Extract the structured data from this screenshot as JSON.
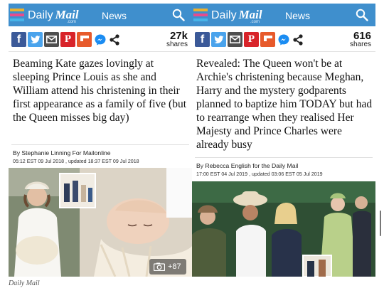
{
  "brand": {
    "name_part1": "Daily",
    "name_part2": "Mail",
    "sub": ".com"
  },
  "colors": {
    "topbar": "#3f8fcd",
    "facebook": "#3b5998",
    "twitter": "#4aa3ec",
    "email": "#4f4f4f",
    "pinterest": "#d8242a",
    "flipboard": "#e75a2b"
  },
  "icons": {
    "menu": "hamburger-menu-icon",
    "search": "search-icon",
    "share": "share-icon",
    "messenger": "messenger-icon",
    "camera": "camera-icon"
  },
  "articles": [
    {
      "section": "News",
      "shares": {
        "count": "27k",
        "label": "shares"
      },
      "headline": "Beaming Kate gazes lovingly at sleeping Prince Louis as she and William attend his christening in their first appearance as a family of five (but the Queen misses big day)",
      "byline": "By Stephanie Linning For Mailonline",
      "dateline": "05:12 EST 09 Jul 2018 , updated 18:37 EST 09 Jul 2018",
      "gallery_count": "+87"
    },
    {
      "section": "News",
      "shares": {
        "count": "616",
        "label": "shares"
      },
      "headline": "Revealed: The Queen won't be at Archie's christening because Meghan, Harry and the mystery godparents planned to baptize him TODAY but had to rearrange when they realised Her Majesty and Prince Charles were already busy",
      "byline": "By Rebecca English for the Daily Mail",
      "dateline": "17:00 EST 04 Jul 2019 , updated 03:06 EST 05 Jul 2019"
    }
  ],
  "credit": "Daily Mail"
}
